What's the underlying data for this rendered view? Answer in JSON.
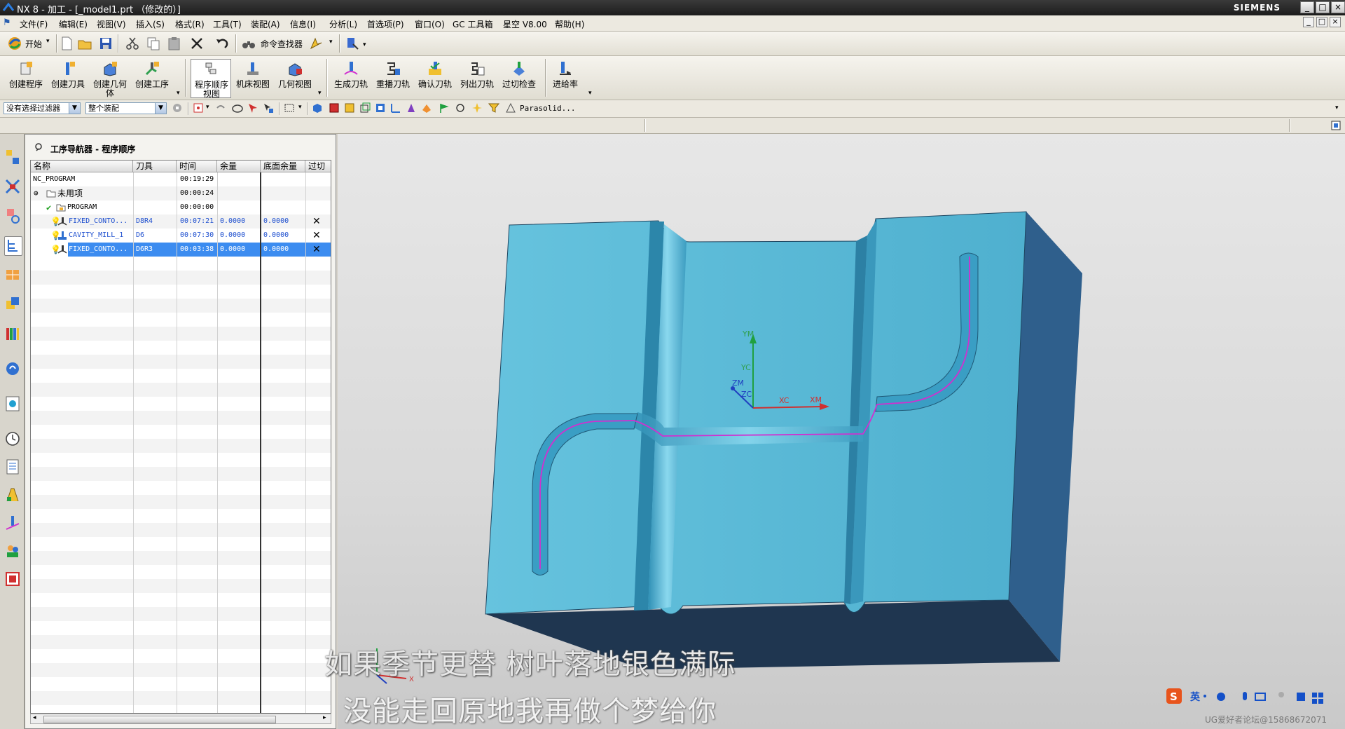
{
  "window": {
    "title": "NX 8 - 加工 - [_model1.prt （修改的）]",
    "brand": "SIEMENS",
    "controls": [
      "_",
      "□",
      "×"
    ]
  },
  "menu": {
    "items": [
      "文件(F)",
      "编辑(E)",
      "视图(V)",
      "插入(S)",
      "格式(R)",
      "工具(T)",
      "装配(A)",
      "信息(I)",
      "分析(L)",
      "首选项(P)",
      "窗口(O)",
      "GC 工具箱",
      "星空 V8.00",
      "帮助(H)"
    ]
  },
  "toolbar1": {
    "start_label": "开始",
    "command_finder_label": "命令查找器"
  },
  "toolbar2": {
    "buttons": [
      "创建程序",
      "创建刀具",
      "创建几何体",
      "创建工序",
      "程序顺序视图",
      "机床视图",
      "几何视图",
      "生成刀轨",
      "重播刀轨",
      "确认刀轨",
      "列出刀轨",
      "过切检查",
      "进给率"
    ]
  },
  "toolbar3": {
    "filter_value": "没有选择过滤器",
    "scope_value": "整个装配",
    "parasolid_label": "Parasolid..."
  },
  "navigator": {
    "title": "工序导航器 - 程序顺序",
    "columns": [
      "名称",
      "刀具",
      "时间",
      "余量",
      "底面余量",
      "过切"
    ],
    "rows": [
      {
        "name": "NC_PROGRAM",
        "tool": "",
        "time": "00:19:29",
        "stock": "",
        "floor": "",
        "gouge": ""
      },
      {
        "name": "未用项",
        "tool": "",
        "time": "00:00:24",
        "stock": "",
        "floor": "",
        "gouge": ""
      },
      {
        "name": "PROGRAM",
        "tool": "",
        "time": "00:00:00",
        "stock": "",
        "floor": "",
        "gouge": ""
      },
      {
        "name": "FIXED_CONTO...",
        "tool": "D8R4",
        "time": "00:07:21",
        "stock": "0.0000",
        "floor": "0.0000",
        "gouge": "✕"
      },
      {
        "name": "CAVITY_MILL_1",
        "tool": "D6",
        "time": "00:07:30",
        "stock": "0.0000",
        "floor": "0.0000",
        "gouge": "✕"
      },
      {
        "name": "FIXED_CONTO...",
        "tool": "D6R3",
        "time": "00:03:38",
        "stock": "0.0000",
        "floor": "0.0000",
        "gouge": "✕"
      }
    ]
  },
  "viewport": {
    "axis_labels": {
      "ym": "YM",
      "yc": "YC",
      "zm": "ZM",
      "zc": "ZC",
      "xc": "XC",
      "xm": "XM"
    },
    "subtitle_line1": "如果季节更替 树叶落地银色满际",
    "subtitle_line2": "没能走回原地我再做个梦给你",
    "ime_label": "英",
    "watermark": "UG爱好者论坛@15868672071"
  },
  "colors": {
    "part_face": "#5fbcd8",
    "part_side": "#2f5f8c",
    "part_bottom": "#1f3650",
    "toolpath": "#d030d0",
    "selection": "#3c8cf0"
  }
}
